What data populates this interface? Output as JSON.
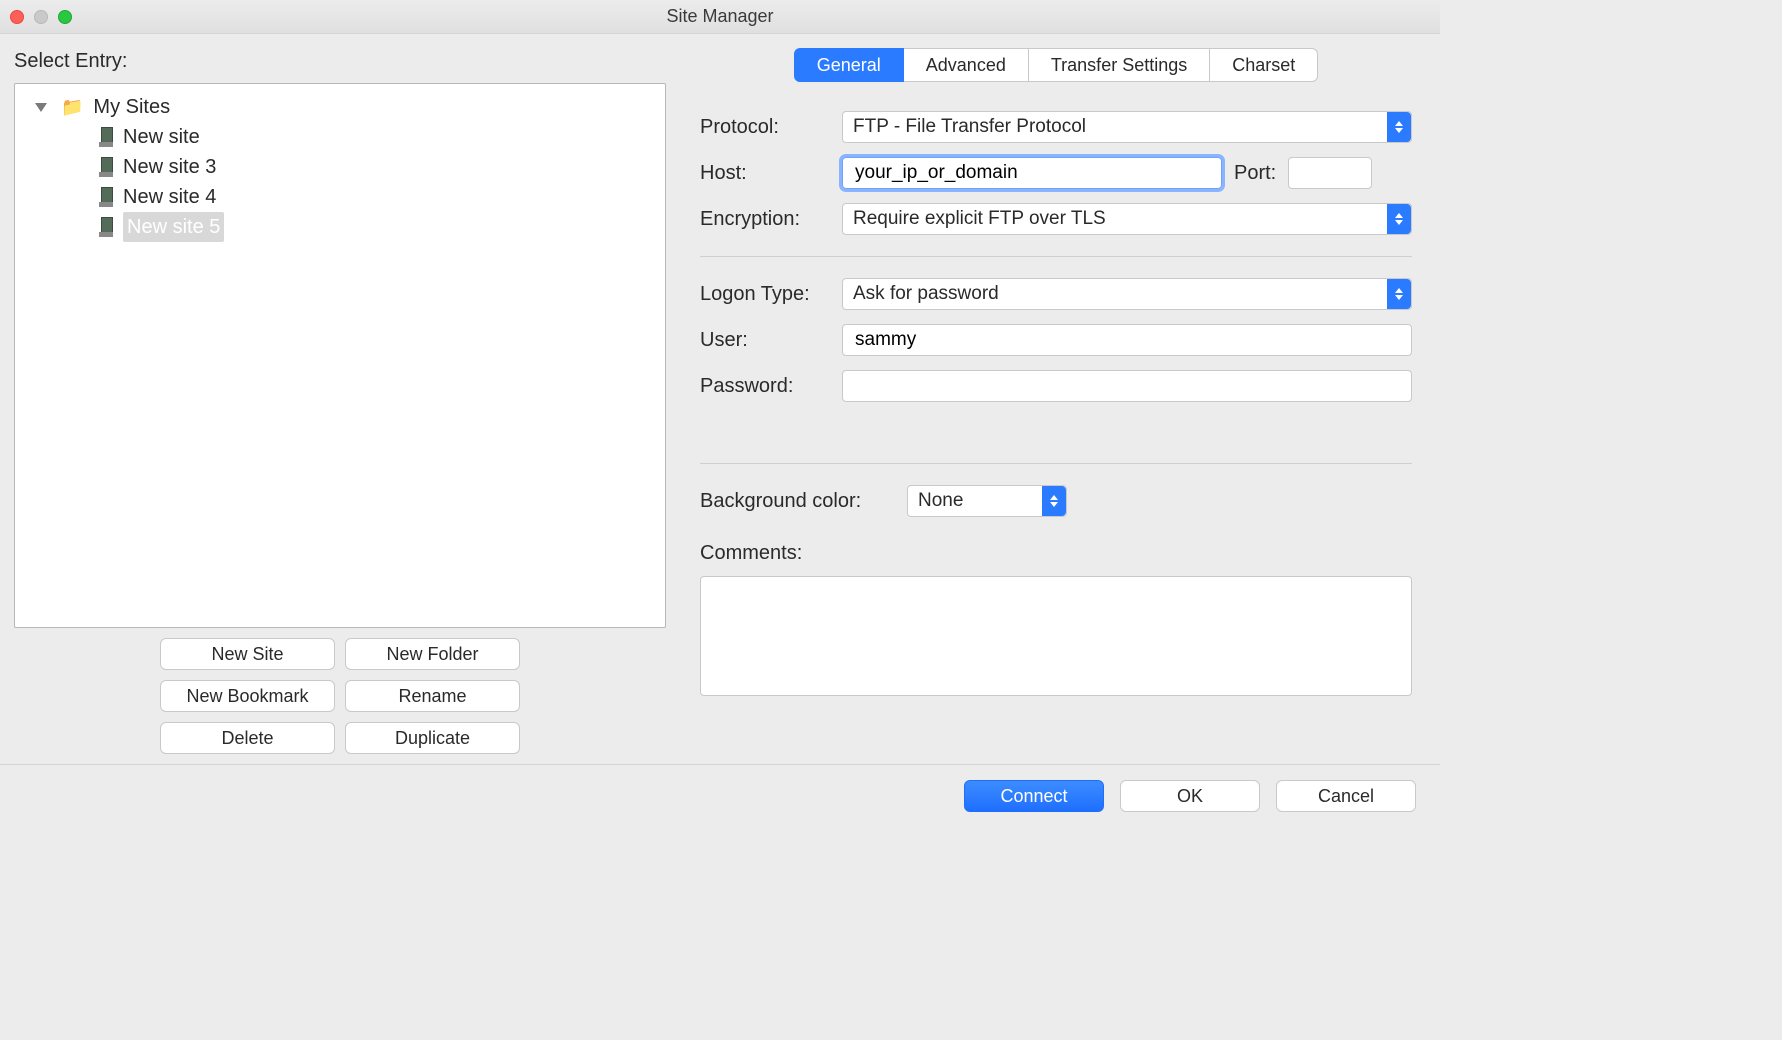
{
  "window": {
    "title": "Site Manager"
  },
  "left": {
    "select_label": "Select Entry:",
    "root_label": "My Sites",
    "items": [
      {
        "label": "New site",
        "selected": false
      },
      {
        "label": "New site 3",
        "selected": false
      },
      {
        "label": "New site 4",
        "selected": false
      },
      {
        "label": "New site 5",
        "selected": true
      }
    ],
    "buttons": {
      "new_site": "New Site",
      "new_folder": "New Folder",
      "new_bookmark": "New Bookmark",
      "rename": "Rename",
      "delete": "Delete",
      "duplicate": "Duplicate"
    }
  },
  "tabs": {
    "general": "General",
    "advanced": "Advanced",
    "transfer": "Transfer Settings",
    "charset": "Charset"
  },
  "form": {
    "protocol_label": "Protocol:",
    "protocol_value": "FTP - File Transfer Protocol",
    "host_label": "Host:",
    "host_value": "your_ip_or_domain",
    "port_label": "Port:",
    "port_value": "",
    "encryption_label": "Encryption:",
    "encryption_value": "Require explicit FTP over TLS",
    "logon_label": "Logon Type:",
    "logon_value": "Ask for password",
    "user_label": "User:",
    "user_value": "sammy",
    "password_label": "Password:",
    "password_value": "",
    "bgcolor_label": "Background color:",
    "bgcolor_value": "None",
    "comments_label": "Comments:",
    "comments_value": ""
  },
  "footer": {
    "connect": "Connect",
    "ok": "OK",
    "cancel": "Cancel"
  }
}
